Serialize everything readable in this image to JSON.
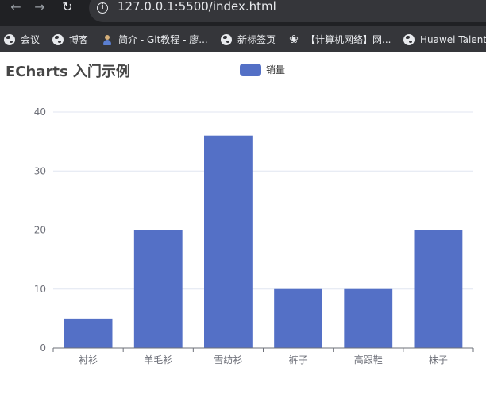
{
  "browser": {
    "url": "127.0.0.1:5500/index.html",
    "bookmarks": [
      {
        "label": "会议",
        "icon": "globe-icon"
      },
      {
        "label": "博客",
        "icon": "globe-icon"
      },
      {
        "label": "简介 - Git教程 - 廖...",
        "icon": "person-icon"
      },
      {
        "label": "新标签页",
        "icon": "globe-icon"
      },
      {
        "label": "【计算机网络】网...",
        "icon": "swirl-icon"
      },
      {
        "label": "Huawei Talent",
        "icon": "globe-icon"
      }
    ]
  },
  "page": {
    "title": "ECharts 入门示例"
  },
  "chart_data": {
    "type": "bar",
    "categories": [
      "衬衫",
      "羊毛衫",
      "雪纺衫",
      "裤子",
      "高跟鞋",
      "袜子"
    ],
    "series": [
      {
        "name": "销量",
        "values": [
          5,
          20,
          36,
          10,
          10,
          20
        ]
      }
    ],
    "ylim": [
      0,
      40
    ],
    "yticks": [
      "0",
      "10",
      "20",
      "30",
      "40"
    ],
    "color": "#5470c6",
    "grid": "horizontal",
    "legend_position": "top-center"
  }
}
